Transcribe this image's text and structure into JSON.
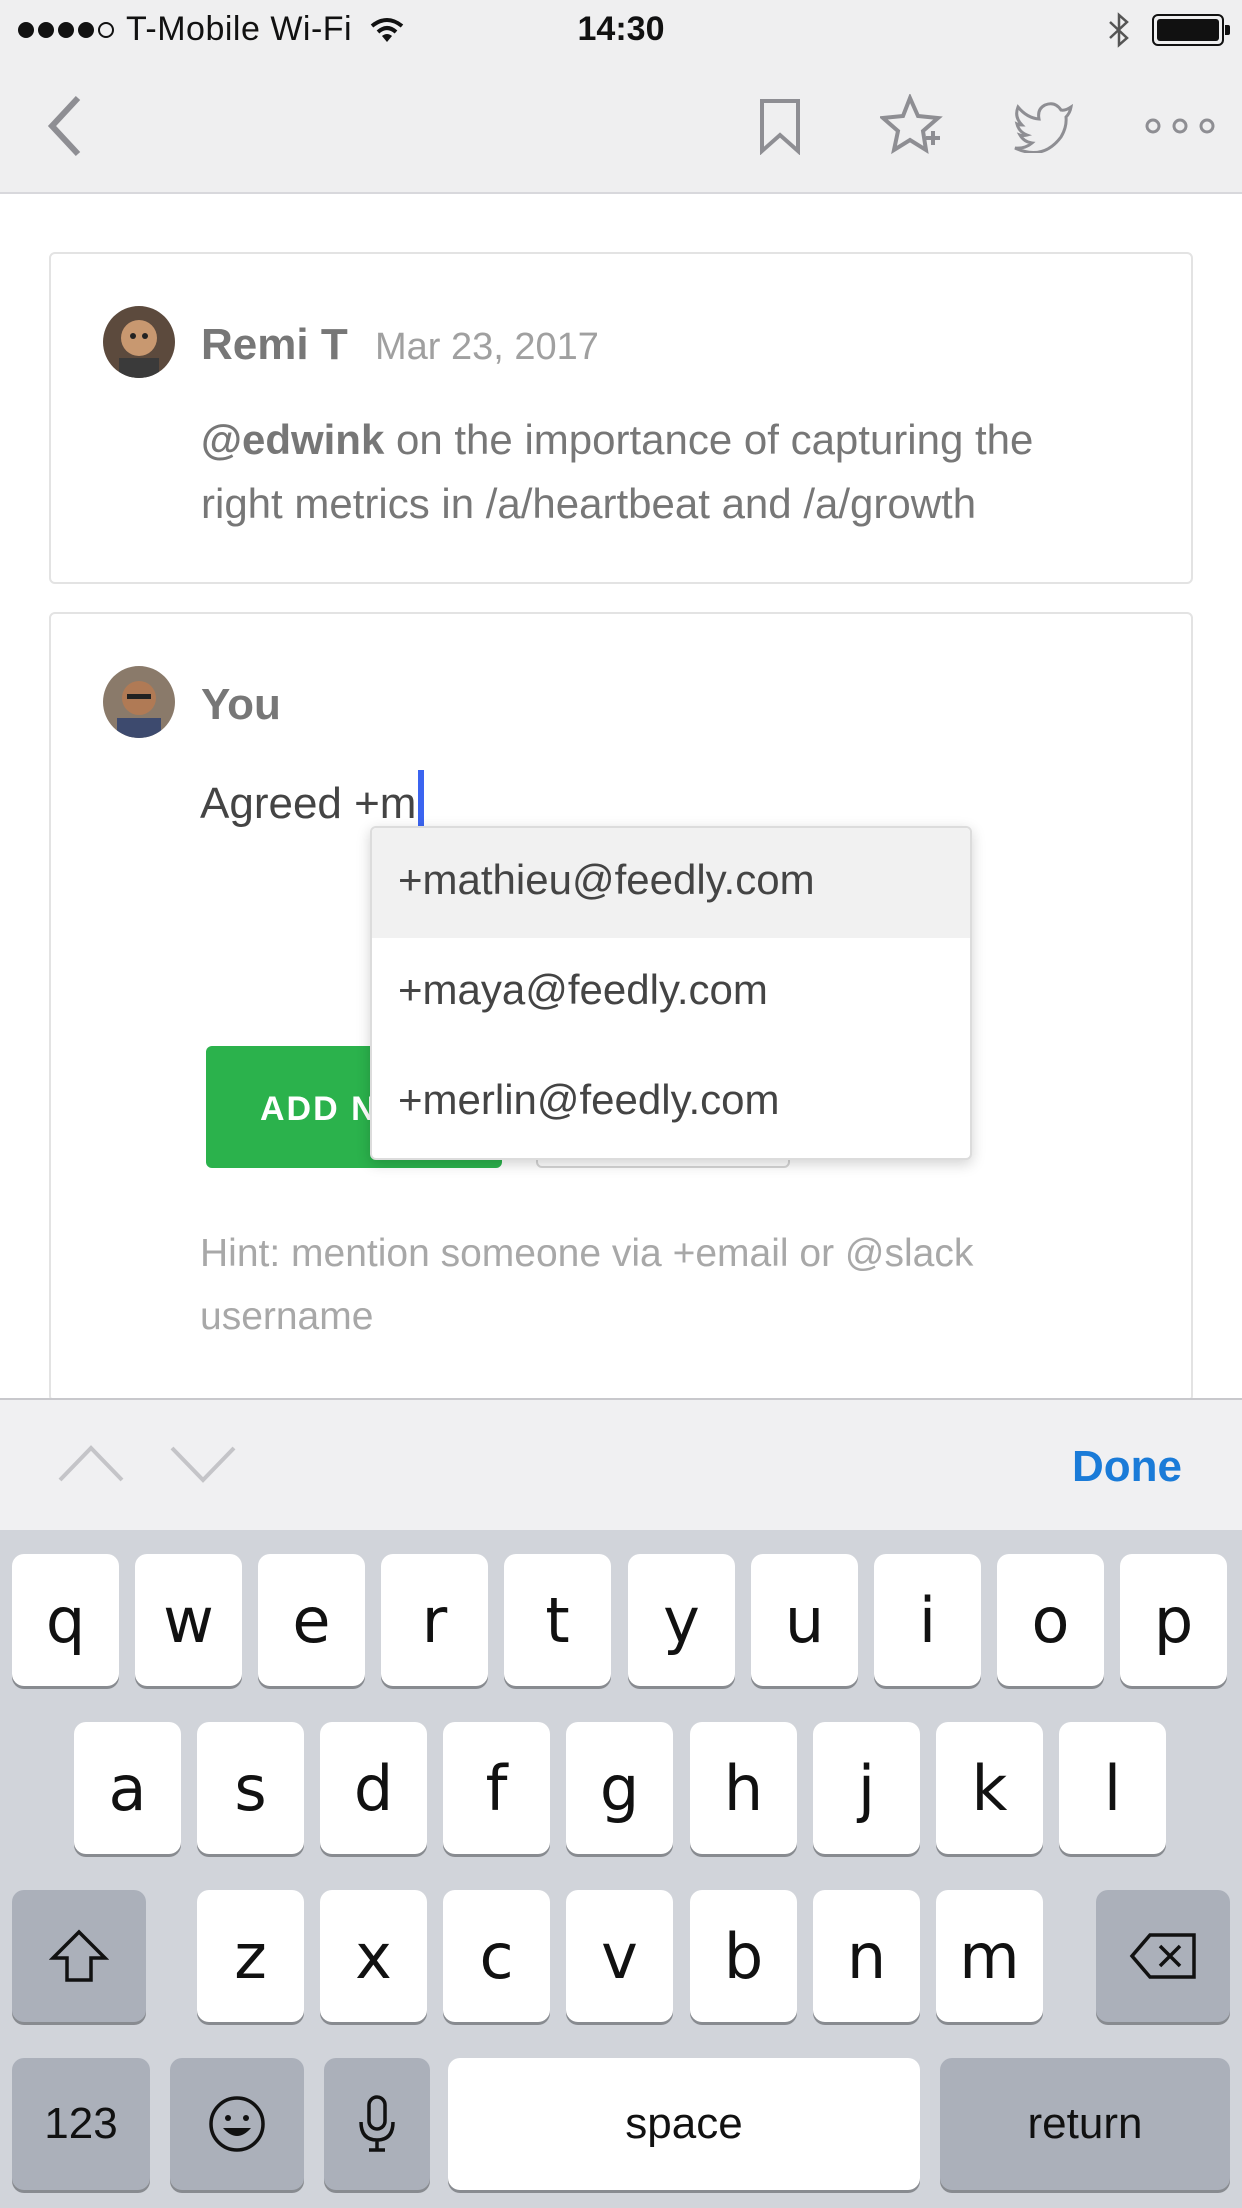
{
  "status_bar": {
    "carrier": "T-Mobile Wi-Fi",
    "time": "14:30",
    "signal_bars_filled": 4,
    "signal_bars_total": 5
  },
  "nav": {
    "icons": [
      "back-chevron-icon",
      "bookmark-icon",
      "favorite-star-icon",
      "twitter-icon",
      "more-icon"
    ]
  },
  "comment": {
    "author": "Remi T",
    "date": "Mar 23, 2017",
    "mention": "@edwink",
    "text_line1": " on the importance of capturing the",
    "text_line2": "right metrics in /a/heartbeat and /a/growth"
  },
  "reply": {
    "author": "You",
    "draft_text": "Agreed +m",
    "add_button_label": "ADD N",
    "hint": "Hint: mention someone via +email or @slack username"
  },
  "suggestions": [
    {
      "label": "+mathieu@feedly.com",
      "highlighted": true
    },
    {
      "label": "+maya@feedly.com",
      "highlighted": false
    },
    {
      "label": "+merlin@feedly.com",
      "highlighted": false
    }
  ],
  "accessory": {
    "done_label": "Done"
  },
  "keyboard": {
    "row1": [
      "q",
      "w",
      "e",
      "r",
      "t",
      "y",
      "u",
      "i",
      "o",
      "p"
    ],
    "row2": [
      "a",
      "s",
      "d",
      "f",
      "g",
      "h",
      "j",
      "k",
      "l"
    ],
    "row3": [
      "z",
      "x",
      "c",
      "v",
      "b",
      "n",
      "m"
    ],
    "numbers_label": "123",
    "space_label": "space",
    "return_label": "return"
  },
  "colors": {
    "accent_green": "#2bb24c",
    "done_blue": "#1a7bd8",
    "cursor_blue": "#3b64f0"
  }
}
